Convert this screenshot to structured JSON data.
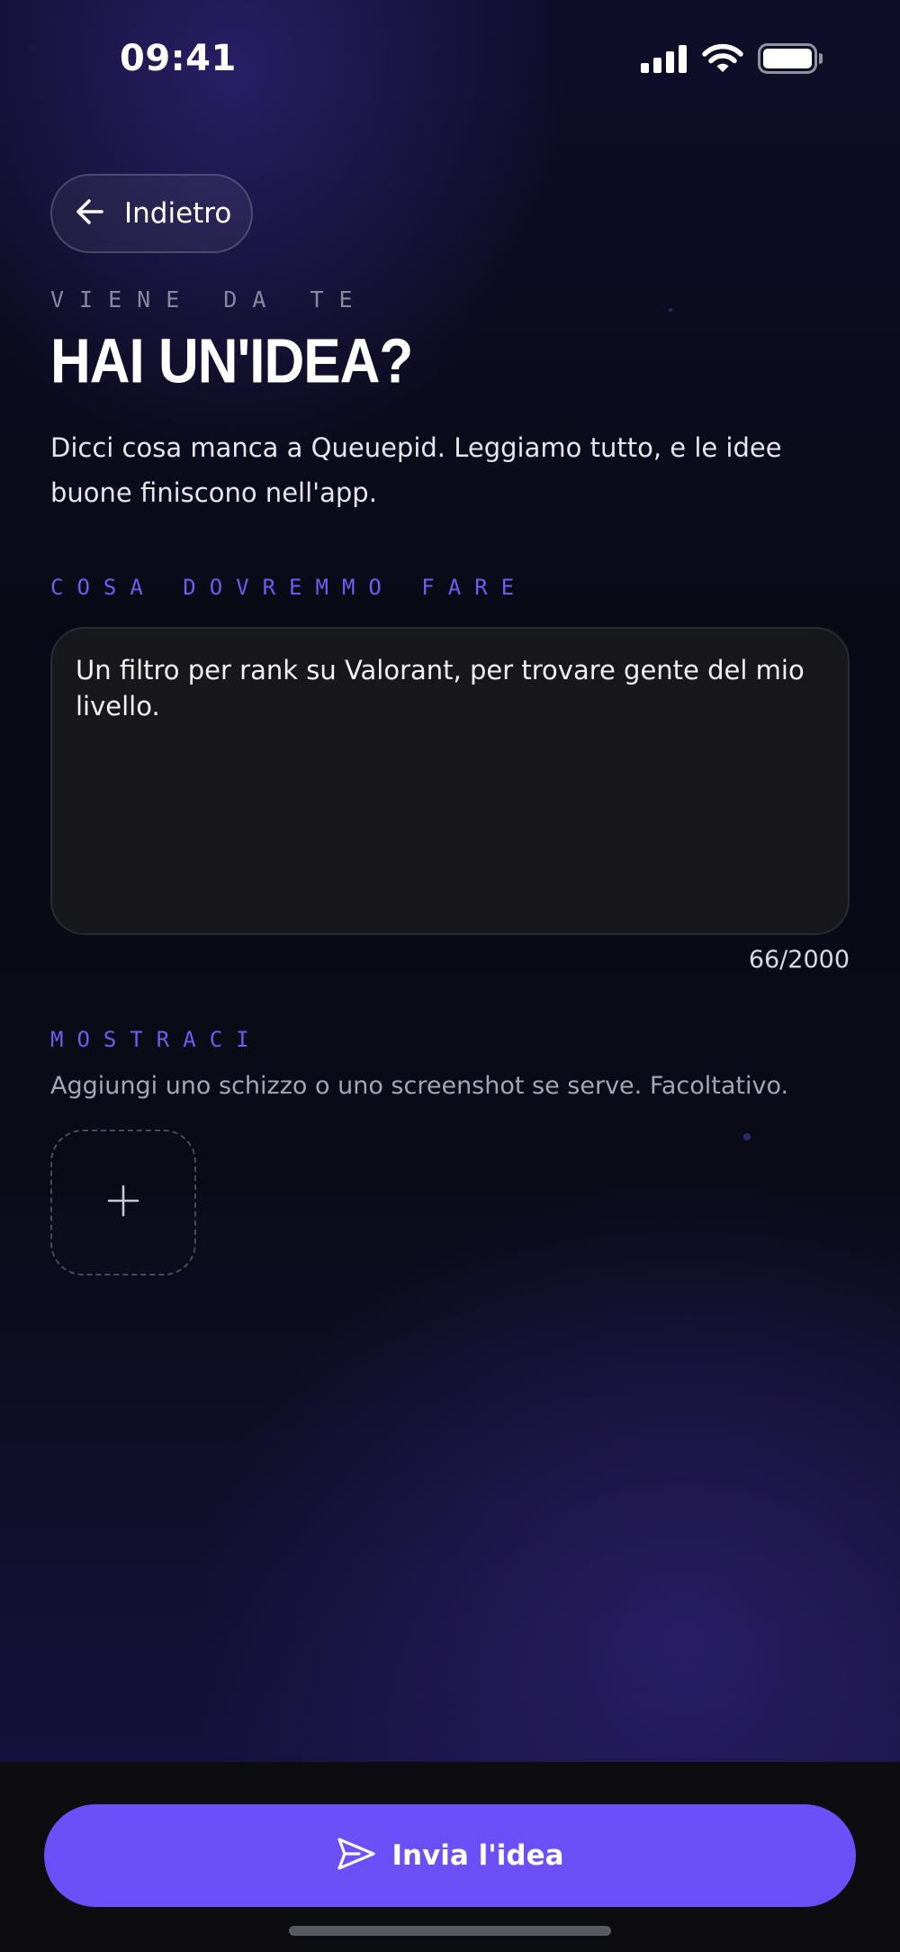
{
  "status_bar": {
    "time": "09:41"
  },
  "header": {
    "back_label": "Indietro"
  },
  "intro": {
    "eyebrow": "VIENE DA TE",
    "title": "HAI UN'IDEA?",
    "subtitle": "Dicci cosa manca a Queuepid. Leggiamo tutto, e le idee buone finiscono nell'app."
  },
  "idea_section": {
    "label": "COSA DOVREMMO FARE",
    "value": "Un filtro per rank su Valorant, per trovare gente del mio livello.",
    "counter": "66/2000"
  },
  "attachment_section": {
    "label": "MOSTRACI",
    "helper": "Aggiungi uno schizzo o uno screenshot se serve. Facoltativo.",
    "add_icon": "plus-icon"
  },
  "footer": {
    "submit_label": "Invia l'idea",
    "submit_icon": "send-icon"
  },
  "colors": {
    "accent": "#6b4ff7",
    "section_label": "#6f5cf0",
    "field_bg": "#18181c",
    "background": "#0a0a16"
  }
}
